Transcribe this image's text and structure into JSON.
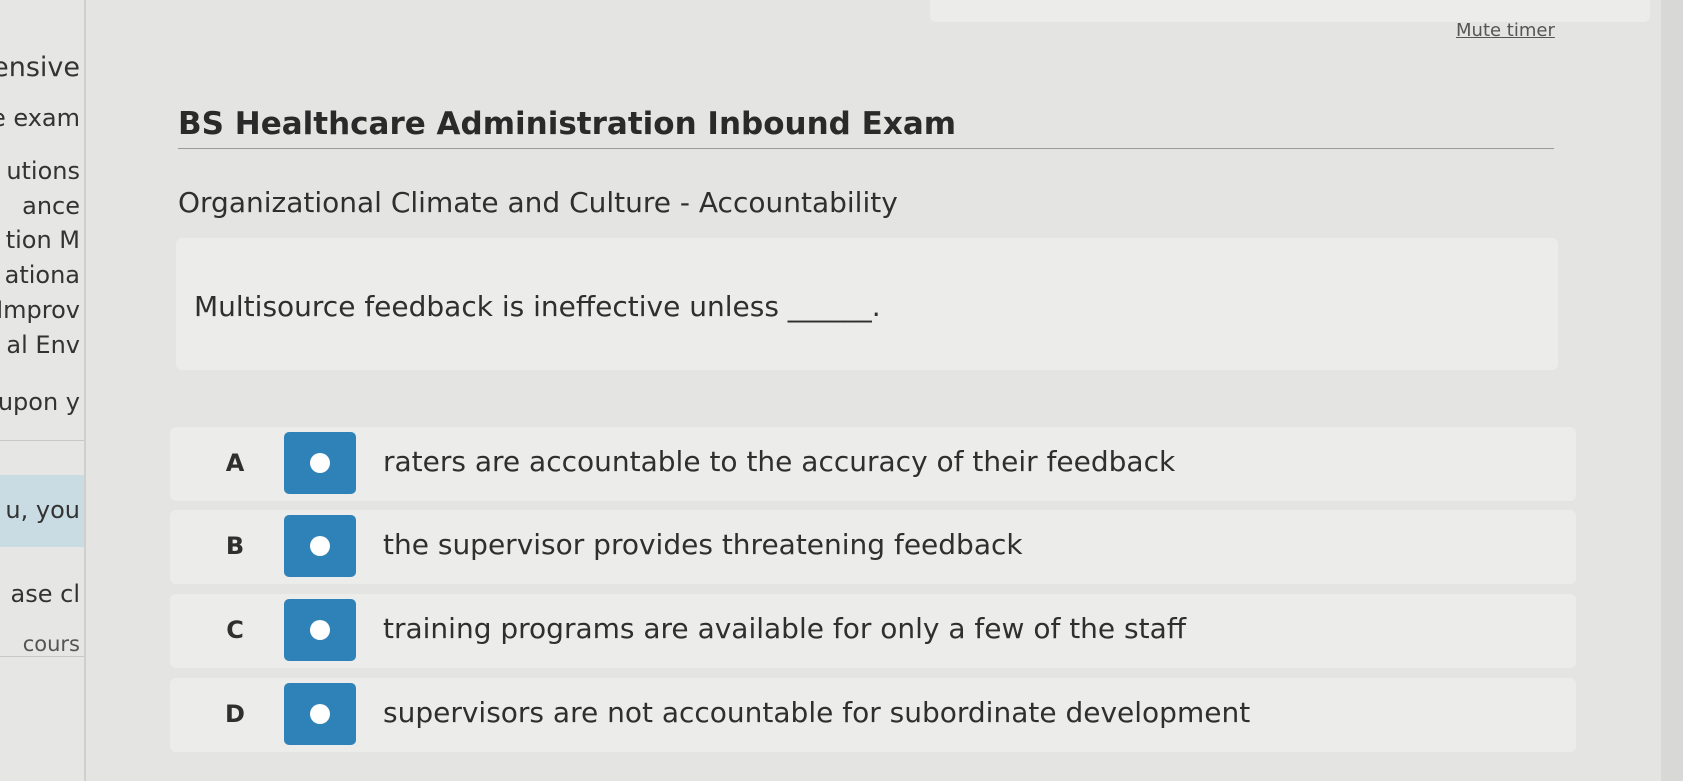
{
  "header": {
    "mute_timer": "Mute timer"
  },
  "sidebar": {
    "lines": [
      "ensive",
      "e exam",
      "utions",
      "ance",
      "tion M",
      "ationa",
      "Improv",
      "al Env",
      "upon y",
      "u, you",
      "ase cl",
      "cours"
    ]
  },
  "exam": {
    "title": "BS Healthcare Administration Inbound Exam",
    "section": "Organizational Climate and Culture - Accountability",
    "question": "Multisource feedback is ineffective unless ______."
  },
  "answers": [
    {
      "letter": "A",
      "text": "raters are accountable to the accuracy of their feedback"
    },
    {
      "letter": "B",
      "text": "the supervisor provides threatening feedback"
    },
    {
      "letter": "C",
      "text": "training programs are available for only a few of the staff"
    },
    {
      "letter": "D",
      "text": "supervisors are not accountable for subordinate development"
    }
  ],
  "colors": {
    "radio_button": "#2f82b8",
    "background": "#e4e4e2",
    "card": "#ececea"
  }
}
